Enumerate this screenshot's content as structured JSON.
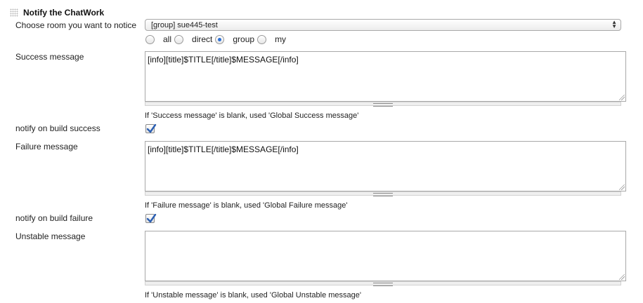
{
  "section": {
    "title": "Notify the ChatWork",
    "grip_icon": "drag-handle-icon"
  },
  "room": {
    "label": "Choose room you want to notice",
    "selected": "[group] sue445-test",
    "radios": [
      {
        "label": "all",
        "checked": false
      },
      {
        "label": "direct",
        "checked": false
      },
      {
        "label": "group",
        "checked": true
      },
      {
        "label": "my",
        "checked": false
      }
    ]
  },
  "success": {
    "label": "Success message",
    "value": "[info][title]$TITLE[/title]$MESSAGE[/info]",
    "hint": "If 'Success message' is blank, used 'Global Success message'"
  },
  "notify_success": {
    "label": "notify on build success",
    "checked": true
  },
  "failure": {
    "label": "Failure message",
    "value": "[info][title]$TITLE[/title]$MESSAGE[/info]",
    "hint": "If 'Failure message' is blank, used 'Global Failure message'"
  },
  "notify_failure": {
    "label": "notify on build failure",
    "checked": true
  },
  "unstable": {
    "label": "Unstable message",
    "value": "",
    "hint": "If 'Unstable message' is blank, used 'Global Unstable message'"
  },
  "colors": {
    "radio_selected": "#2a6fd6",
    "checkmark": "#2b5fb3"
  }
}
